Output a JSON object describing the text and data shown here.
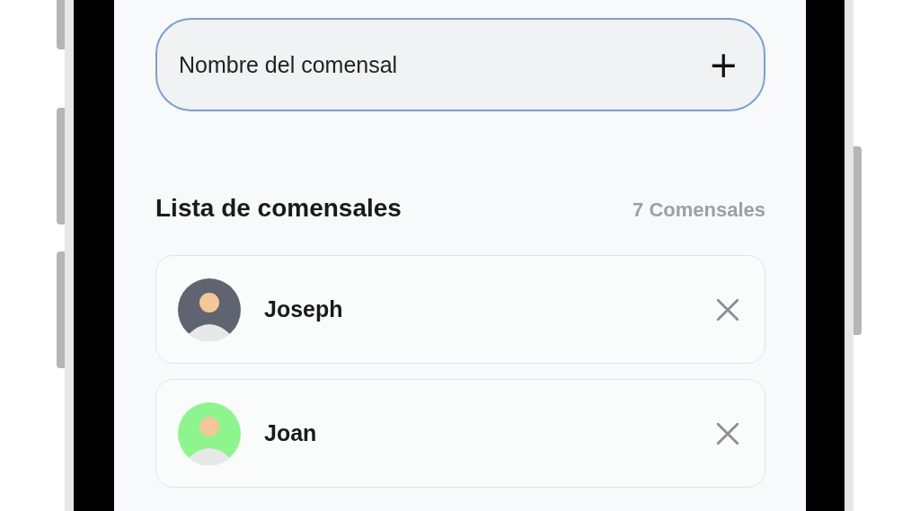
{
  "name_field": {
    "placeholder": "Nombre del comensal",
    "add_icon": "+"
  },
  "list": {
    "title": "Lista de comensales",
    "count": "7 Comensales",
    "diners": [
      {
        "name": "Joseph",
        "color": "#5f6470"
      },
      {
        "name": "Joan",
        "color": "#8ef58e"
      }
    ]
  }
}
